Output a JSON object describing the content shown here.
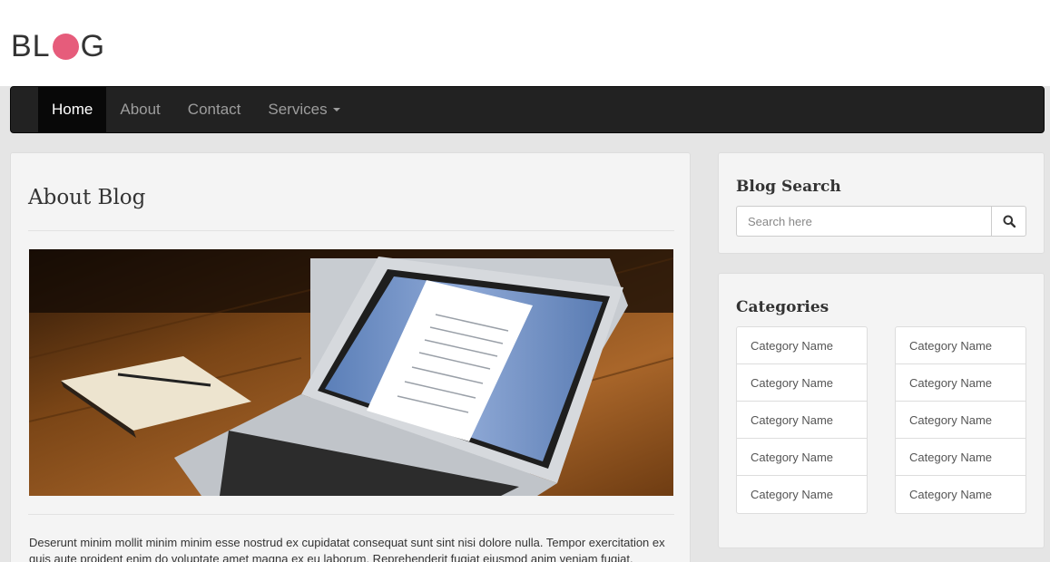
{
  "logo": {
    "prefix": "BL",
    "suffix": "G",
    "dot_color": "#e65c7b"
  },
  "nav": {
    "items": [
      {
        "label": "Home",
        "active": true
      },
      {
        "label": "About"
      },
      {
        "label": "Contact"
      },
      {
        "label": "Services",
        "has_dropdown": true
      }
    ]
  },
  "main": {
    "title": "About Blog",
    "image_icon": "laptop-on-desk-photo",
    "body_text": "Deserunt minim mollit minim minim esse nostrud ex cupidatat consequat sunt sint nisi dolore nulla. Tempor exercitation ex quis aute proident enim do voluptate amet magna ex eu laborum. Reprehenderit fugiat eiusmod anim veniam fugiat."
  },
  "search": {
    "title": "Blog Search",
    "placeholder": "Search here",
    "button_icon": "search-icon"
  },
  "categories": {
    "title": "Categories",
    "left": [
      "Category Name",
      "Category Name",
      "Category Name",
      "Category Name",
      "Category Name"
    ],
    "right": [
      "Category Name",
      "Category Name",
      "Category Name",
      "Category Name",
      "Category Name"
    ]
  }
}
